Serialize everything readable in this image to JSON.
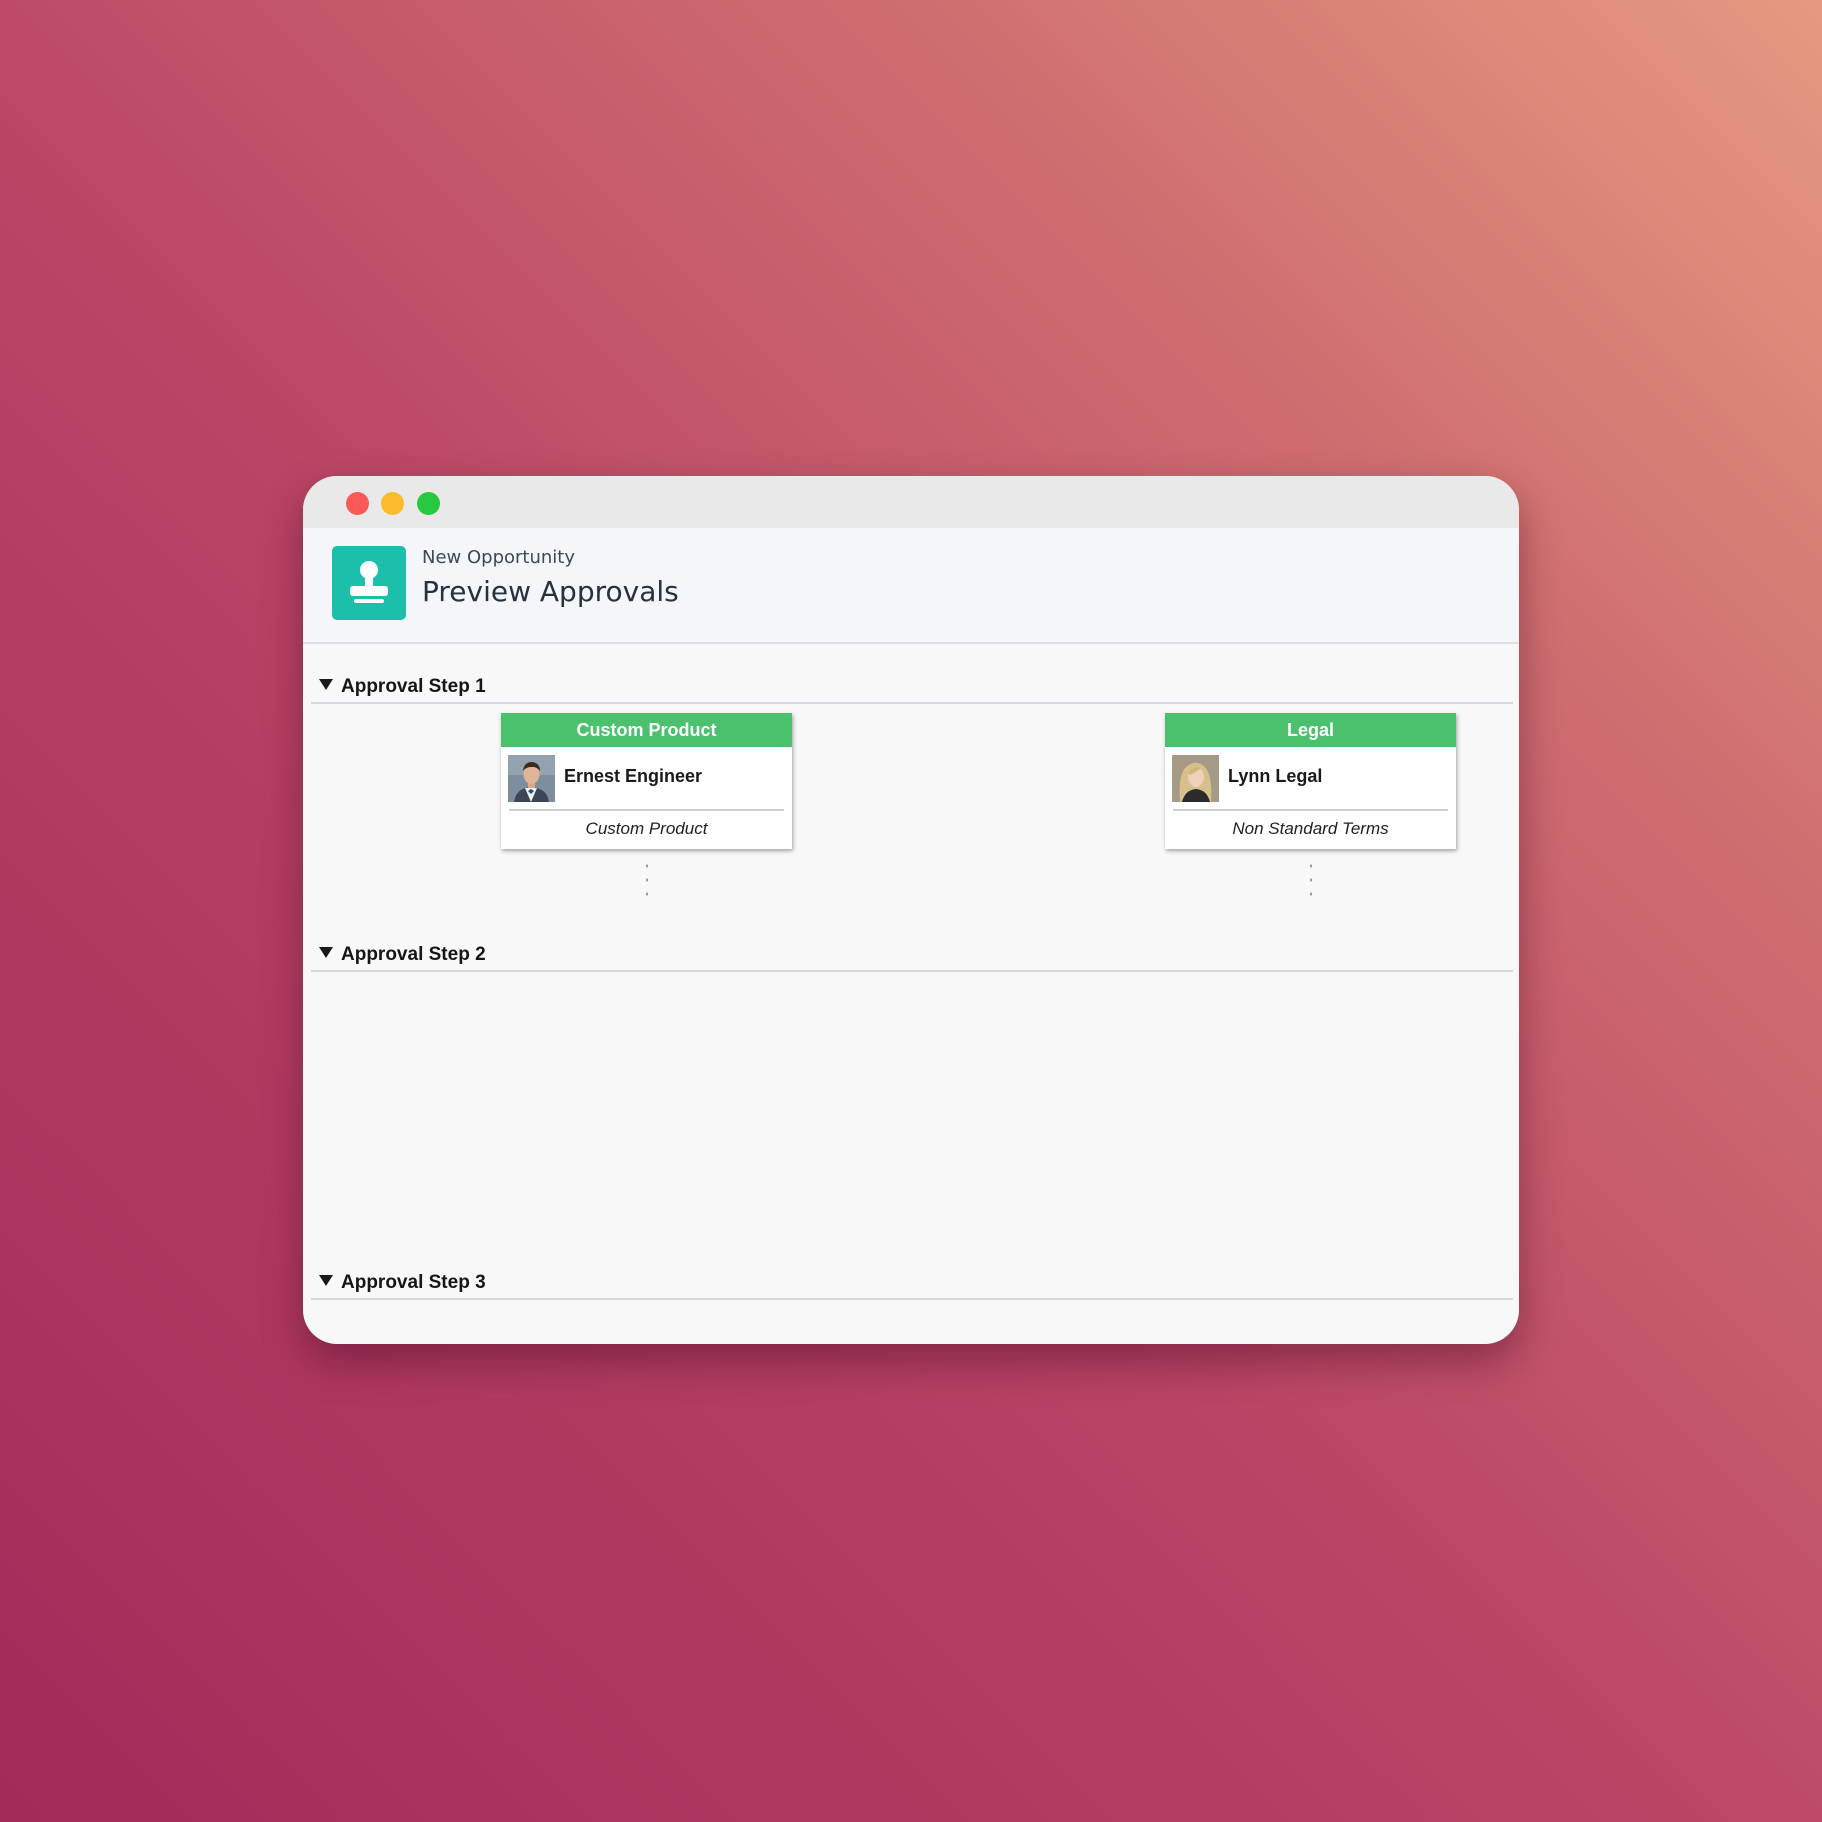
{
  "window": {
    "controls": [
      "close",
      "minimize",
      "zoom"
    ]
  },
  "header": {
    "icon": "approval-stamp-icon",
    "subtitle": "New Opportunity",
    "title": "Preview Approvals"
  },
  "steps": [
    {
      "label": "Approval Step 1",
      "expanded": true,
      "approvals": [
        {
          "group": "Custom Product",
          "approver": "Ernest Engineer",
          "reason": "Custom Product"
        },
        {
          "group": "Legal",
          "approver": "Lynn Legal",
          "reason": "Non Standard Terms"
        }
      ]
    },
    {
      "label": "Approval Step 2",
      "expanded": true
    },
    {
      "label": "Approval Step 3",
      "expanded": true
    }
  ],
  "colors": {
    "card_header": "#4bc16e",
    "app_icon": "#1cbfa9"
  }
}
